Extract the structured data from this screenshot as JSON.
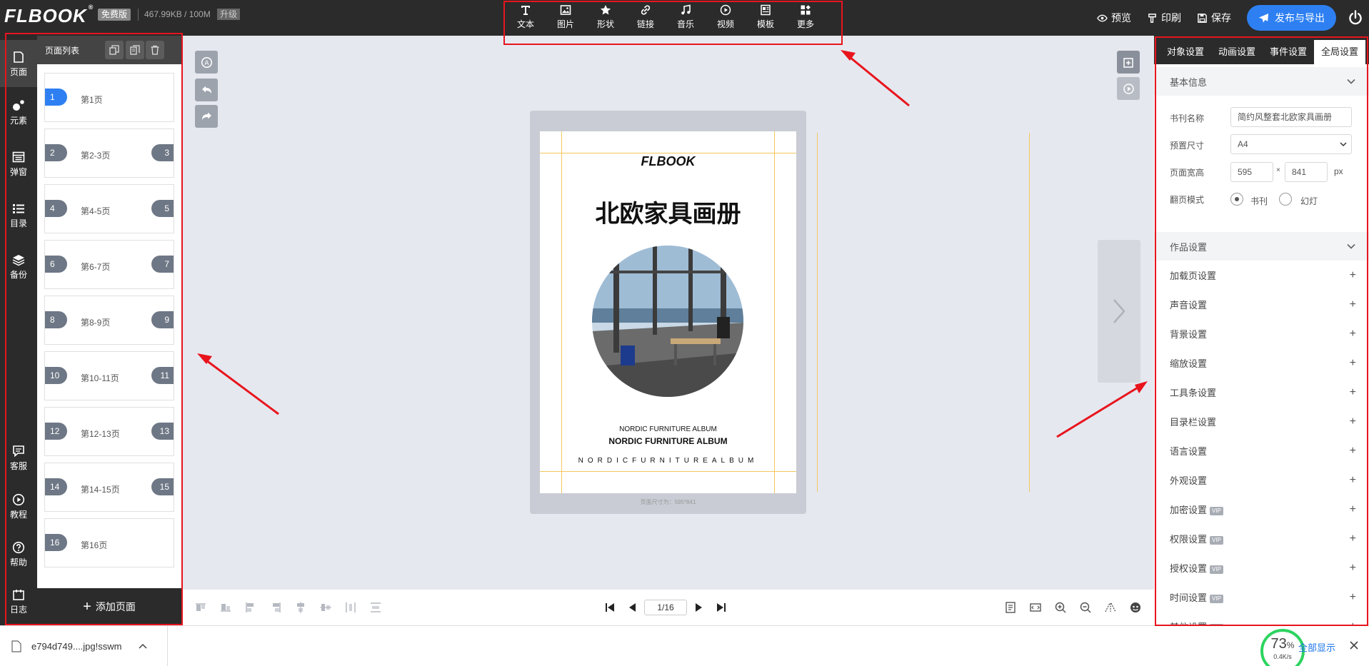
{
  "app": {
    "logo": "FLBOOK",
    "plan_badge": "免费版",
    "storage": "467.99KB / 100M",
    "upgrade": "升级"
  },
  "toolbar": [
    {
      "label": "文本",
      "icon": "text-icon"
    },
    {
      "label": "图片",
      "icon": "image-icon"
    },
    {
      "label": "形状",
      "icon": "star-icon"
    },
    {
      "label": "链接",
      "icon": "link-icon"
    },
    {
      "label": "音乐",
      "icon": "music-icon"
    },
    {
      "label": "视频",
      "icon": "video-icon"
    },
    {
      "label": "模板",
      "icon": "template-icon"
    },
    {
      "label": "更多",
      "icon": "more-icon"
    }
  ],
  "header_actions": {
    "preview": "预览",
    "print": "印刷",
    "save": "保存",
    "publish": "发布与导出"
  },
  "left_nav": [
    {
      "label": "页面",
      "icon": "page-icon"
    },
    {
      "label": "元素",
      "icon": "elements-icon"
    },
    {
      "label": "弹窗",
      "icon": "popup-icon"
    },
    {
      "label": "目录",
      "icon": "catalog-icon"
    },
    {
      "label": "备份",
      "icon": "backup-icon"
    },
    {
      "label": "客服",
      "icon": "chat-icon"
    },
    {
      "label": "教程",
      "icon": "play-circle-icon"
    },
    {
      "label": "帮助",
      "icon": "help-icon"
    },
    {
      "label": "日志",
      "icon": "log-icon"
    }
  ],
  "page_list": {
    "title": "页面列表",
    "pages": [
      {
        "num_left": "1",
        "num_right": "",
        "label": "第1页"
      },
      {
        "num_left": "2",
        "num_right": "3",
        "label": "第2-3页"
      },
      {
        "num_left": "4",
        "num_right": "5",
        "label": "第4-5页"
      },
      {
        "num_left": "6",
        "num_right": "7",
        "label": "第6-7页"
      },
      {
        "num_left": "8",
        "num_right": "9",
        "label": "第8-9页"
      },
      {
        "num_left": "10",
        "num_right": "11",
        "label": "第10-11页"
      },
      {
        "num_left": "12",
        "num_right": "13",
        "label": "第12-13页"
      },
      {
        "num_left": "14",
        "num_right": "15",
        "label": "第14-15页"
      },
      {
        "num_left": "16",
        "num_right": "",
        "label": "第16页"
      }
    ],
    "add_page": "添加页面"
  },
  "canvas": {
    "logo_text": "FLBOOK",
    "title": "北欧家具画册",
    "sub1": "NORDIC FURNITURE ALBUM",
    "sub2": "NORDIC FURNITURE ALBUM",
    "spaced": "NORDICFURNITUREALBUM",
    "size_note": "页面尺寸为：595*841"
  },
  "pager": {
    "current": "1/16"
  },
  "right_panel": {
    "tabs": [
      "对象设置",
      "动画设置",
      "事件设置",
      "全局设置"
    ],
    "basic_info": "基本信息",
    "book_name_label": "书刊名称",
    "book_name": "简约风整套北欧家具画册",
    "preset_size_label": "预置尺寸",
    "preset_size": "A4",
    "page_size_label": "页面宽高",
    "width": "595",
    "height": "841",
    "unit": "px",
    "times": "×",
    "flip_mode_label": "翻页模式",
    "flip_book": "书刊",
    "flip_slide": "幻灯",
    "work_settings": "作品设置",
    "items": [
      {
        "label": "加载页设置",
        "vip": ""
      },
      {
        "label": "声音设置",
        "vip": ""
      },
      {
        "label": "背景设置",
        "vip": ""
      },
      {
        "label": "缩放设置",
        "vip": ""
      },
      {
        "label": "工具条设置",
        "vip": ""
      },
      {
        "label": "目录栏设置",
        "vip": ""
      },
      {
        "label": "语言设置",
        "vip": ""
      },
      {
        "label": "外观设置",
        "vip": ""
      },
      {
        "label": "加密设置",
        "vip": "VIP"
      },
      {
        "label": "权限设置",
        "vip": "VIP"
      },
      {
        "label": "授权设置",
        "vip": "VIP"
      },
      {
        "label": "时间设置",
        "vip": "VIP"
      },
      {
        "label": "其他设置",
        "vip": "VIP"
      }
    ]
  },
  "download_bar": {
    "filename": "e794d749....jpg!sswm",
    "speed_pct": "73",
    "pct_sign": "%",
    "speed": "0.4K/s",
    "show_all": "全部显示"
  },
  "colors": {
    "accent": "#2e80f2",
    "dark": "#2b2b2b",
    "annotation": "#e8141d",
    "guide": "#f3c75e"
  }
}
